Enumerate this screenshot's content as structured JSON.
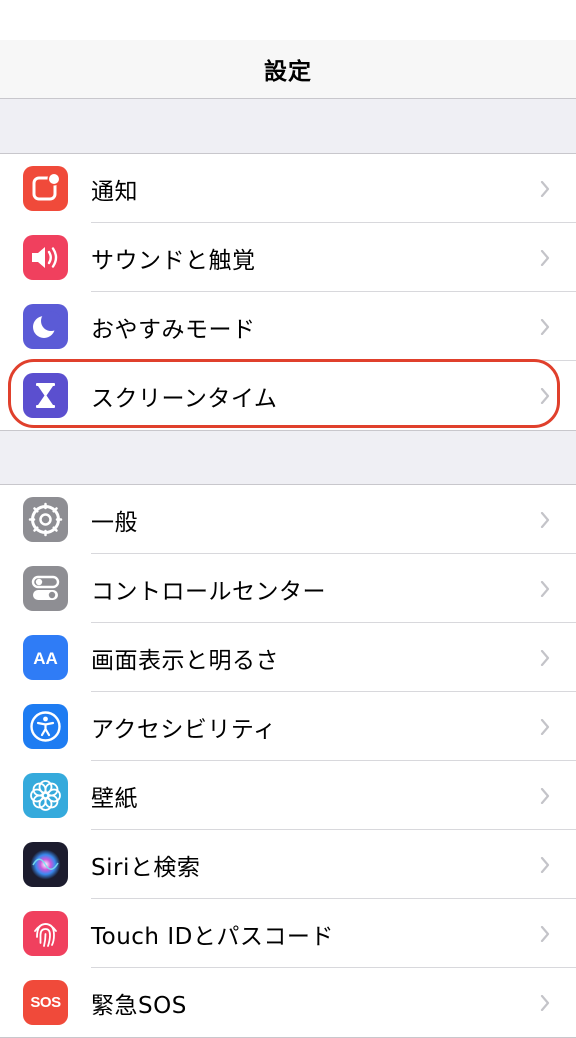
{
  "nav": {
    "title": "設定"
  },
  "groups": [
    {
      "items": [
        {
          "label": "通知",
          "icon": "notifications-icon",
          "color": "#f04a3a"
        },
        {
          "label": "サウンドと触覚",
          "icon": "sounds-icon",
          "color": "#f0405e"
        },
        {
          "label": "おやすみモード",
          "icon": "moon-icon",
          "color": "#5b5bd6"
        },
        {
          "label": "スクリーンタイム",
          "icon": "hourglass-icon",
          "color": "#5b4fcf"
        }
      ]
    },
    {
      "items": [
        {
          "label": "一般",
          "icon": "gear-icon",
          "color": "#8e8e93"
        },
        {
          "label": "コントロールセンター",
          "icon": "toggles-icon",
          "color": "#8e8e93"
        },
        {
          "label": "画面表示と明るさ",
          "icon": "display-aa-icon",
          "color": "#2f7cf6"
        },
        {
          "label": "アクセシビリティ",
          "icon": "accessibility-icon",
          "color": "#1e7cf2"
        },
        {
          "label": "壁紙",
          "icon": "wallpaper-flower-icon",
          "color": "#35aadc"
        },
        {
          "label": "Siriと検索",
          "icon": "siri-icon",
          "color": "#1c1c2e"
        },
        {
          "label": "Touch IDとパスコード",
          "icon": "fingerprint-icon",
          "color": "#f0405e"
        },
        {
          "label": "緊急SOS",
          "icon": "sos-icon",
          "color": "#f04a3a",
          "icon_text": "SOS"
        }
      ]
    }
  ],
  "highlighted_item": "スクリーンタイム"
}
